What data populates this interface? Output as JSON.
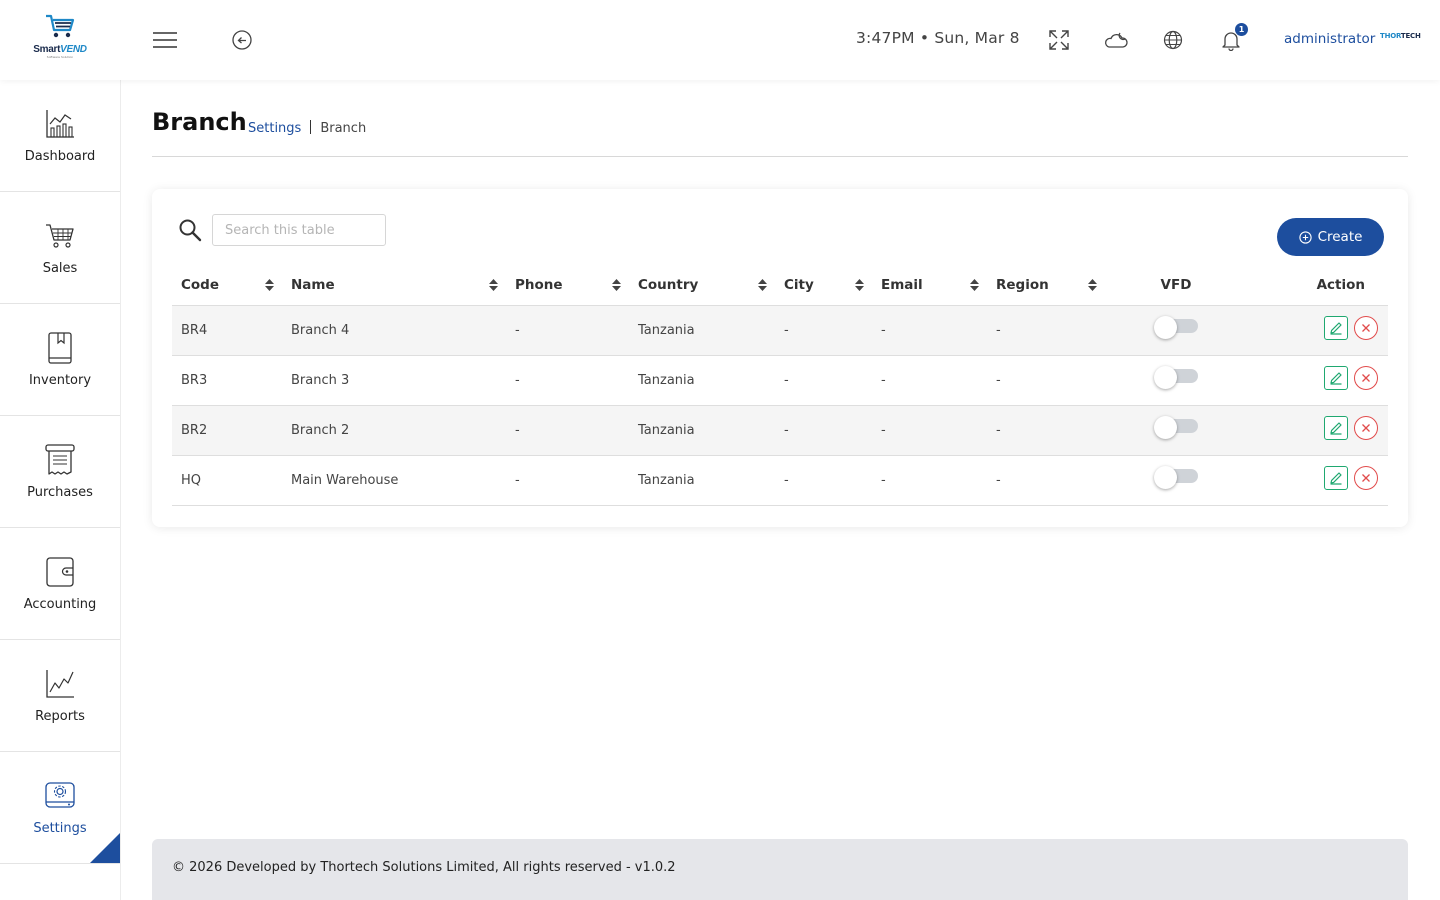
{
  "header": {
    "logo": {
      "name": "SmartVEND",
      "name_part1": "Smart",
      "name_part2": "VEND",
      "tagline": "Software Solution"
    },
    "datetime": "3:47PM • Sun, Mar 8",
    "notification_count": "1",
    "username": "administrator",
    "brand_logo": {
      "part1": "THOR",
      "part2": "TECH"
    }
  },
  "sidebar": {
    "items": [
      {
        "label": "Dashboard",
        "icon": "chart-icon"
      },
      {
        "label": "Sales",
        "icon": "cart-icon"
      },
      {
        "label": "Inventory",
        "icon": "book-icon"
      },
      {
        "label": "Purchases",
        "icon": "receipt-icon"
      },
      {
        "label": "Accounting",
        "icon": "wallet-icon"
      },
      {
        "label": "Reports",
        "icon": "line-chart-icon"
      },
      {
        "label": "Settings",
        "icon": "settings-icon",
        "active": true
      }
    ]
  },
  "page": {
    "title": "Branch",
    "breadcrumb": {
      "parent": "Settings",
      "current": "Branch"
    }
  },
  "table": {
    "search_placeholder": "Search this table",
    "create_label": "Create",
    "columns": [
      "Code",
      "Name",
      "Phone",
      "Country",
      "City",
      "Email",
      "Region",
      "VFD",
      "Action"
    ],
    "rows": [
      {
        "code": "BR4",
        "name": "Branch 4",
        "phone": "-",
        "country": "Tanzania",
        "city": "-",
        "email": "-",
        "region": "-",
        "vfd": false
      },
      {
        "code": "BR3",
        "name": "Branch 3",
        "phone": "-",
        "country": "Tanzania",
        "city": "-",
        "email": "-",
        "region": "-",
        "vfd": false
      },
      {
        "code": "BR2",
        "name": "Branch 2",
        "phone": "-",
        "country": "Tanzania",
        "city": "-",
        "email": "-",
        "region": "-",
        "vfd": false
      },
      {
        "code": "HQ",
        "name": "Main Warehouse",
        "phone": "-",
        "country": "Tanzania",
        "city": "-",
        "email": "-",
        "region": "-",
        "vfd": false
      }
    ]
  },
  "footer": {
    "text": "© 2026 Developed by Thortech Solutions Limited, All rights reserved - v1.0.2"
  },
  "colors": {
    "primary": "#1d4e9e",
    "edit": "#1fa870",
    "delete": "#e14b4b",
    "footer_bg": "#e5e6ea"
  }
}
